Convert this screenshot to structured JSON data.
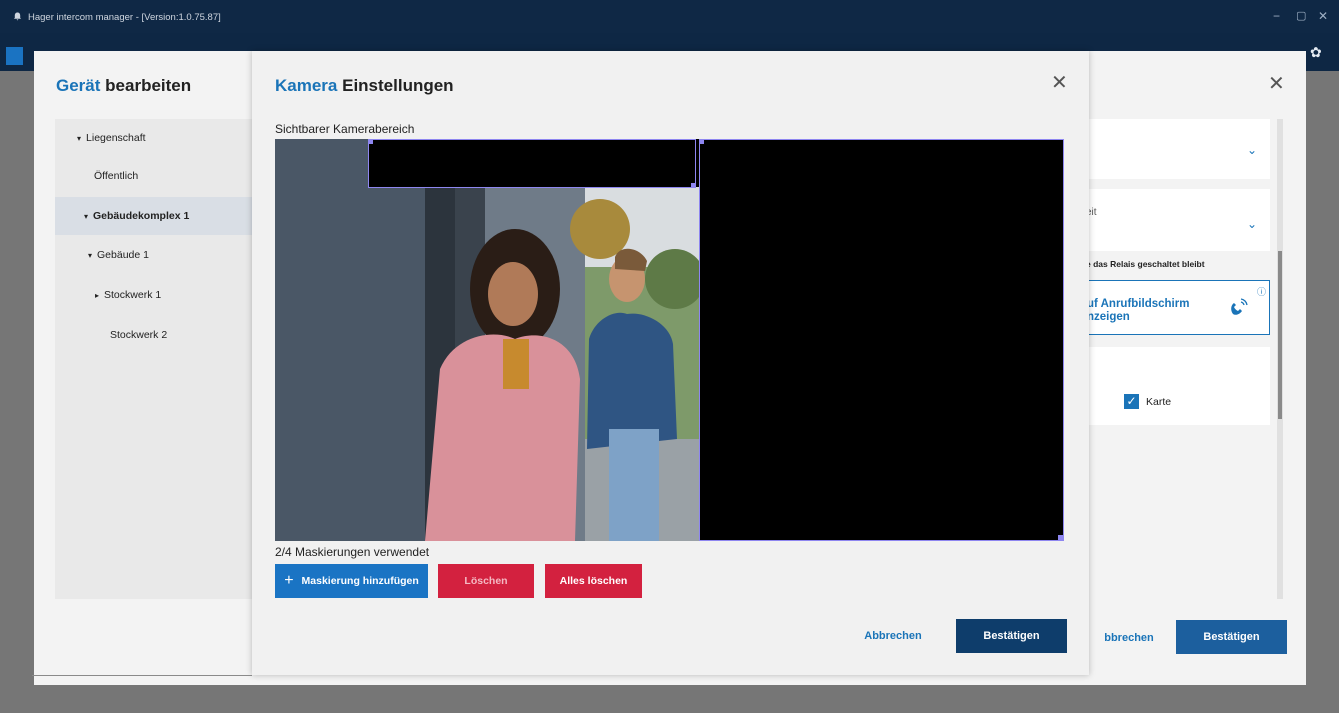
{
  "window": {
    "title": "Hager intercom manager - [Version:1.0.75.87]",
    "minimize": "−",
    "maximize": "▢",
    "close": "✕"
  },
  "bg_dialog": {
    "title_accent": "Gerät",
    "title_rest": "bearbeiten",
    "close": "✕",
    "tree": [
      {
        "label": "Liegenschaft",
        "caret": "▾"
      },
      {
        "label": "Öffentlich",
        "caret": ""
      },
      {
        "label": "Gebäudekomplex 1",
        "caret": "▾",
        "selected": true
      },
      {
        "label": "Gebäude 1",
        "caret": "▾"
      },
      {
        "label": "Stockwerk 1",
        "caret": "▸"
      },
      {
        "label": "Stockwerk 2",
        "caret": ""
      }
    ],
    "right": {
      "field2_label_fragment": "eit",
      "field2_value_fragment": ":",
      "relay_note": "e das Relais geschaltet bleibt",
      "call_screen_line1": "uf Anrufbildschirm",
      "call_screen_line2": "nzeigen",
      "info": "ⓘ",
      "karte_label": "Karte"
    },
    "cancel": "bbrechen",
    "confirm": "Bestätigen"
  },
  "dialog": {
    "title_accent": "Kamera",
    "title_rest": "Einstellungen",
    "close": "✕",
    "area_label": "Sichtbarer Kamerabereich",
    "masks_used": "2/4 Maskierungen verwendet",
    "add_mask": "Maskierung hinzufügen",
    "delete": "Löschen",
    "delete_all": "Alles löschen",
    "cancel": "Abbrechen",
    "confirm": "Bestätigen"
  },
  "colors": {
    "brand_blue": "#1a74b8",
    "confirm_dark": "#0e3d6b",
    "danger": "#d3213f",
    "mask_outline": "#8e86f0"
  }
}
